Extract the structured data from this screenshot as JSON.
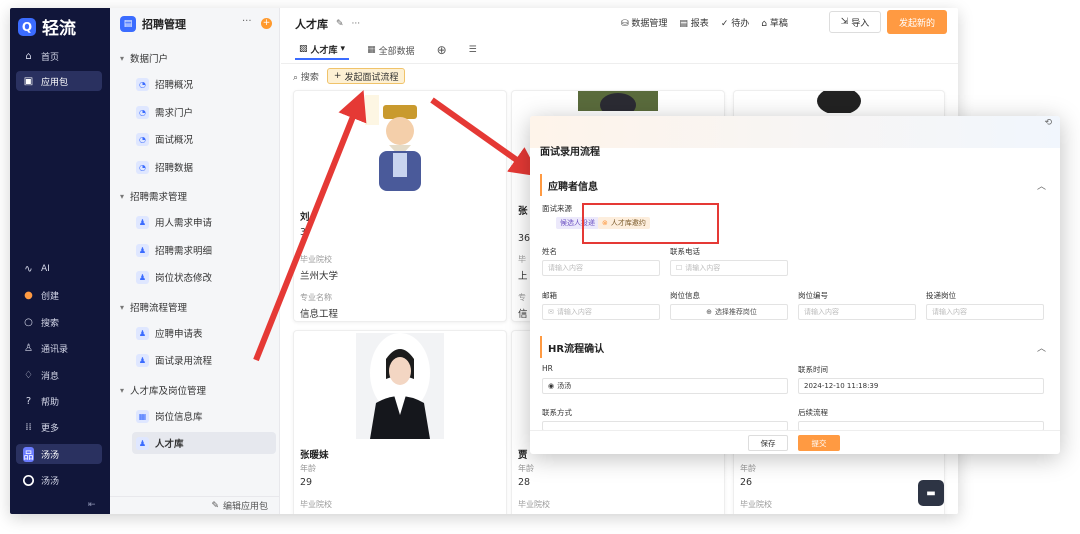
{
  "nav": {
    "brand": "轻流",
    "items": [
      {
        "label": "首页",
        "icon": "home-icon"
      },
      {
        "label": "应用包",
        "icon": "apps-icon"
      }
    ],
    "bottom_items": [
      {
        "label": "AI",
        "icon": "ai-icon"
      },
      {
        "label": "创建",
        "icon": "create-icon"
      },
      {
        "label": "搜索",
        "icon": "search-icon"
      },
      {
        "label": "通讯录",
        "icon": "contacts-icon"
      },
      {
        "label": "消息",
        "icon": "bell-icon"
      },
      {
        "label": "帮助",
        "icon": "help-icon"
      },
      {
        "label": "更多",
        "icon": "grid-icon"
      },
      {
        "label": "汤汤",
        "icon": "workspace-icon"
      },
      {
        "label": "汤汤",
        "icon": "user-avatar-icon"
      }
    ]
  },
  "sidebar": {
    "app_name": "招聘管理",
    "groups": [
      {
        "label": "数据门户",
        "items": [
          "招聘概况",
          "需求门户",
          "面试概况",
          "招聘数据"
        ]
      },
      {
        "label": "招聘需求管理",
        "items": [
          "用人需求申请",
          "招聘需求明细",
          "岗位状态修改"
        ]
      },
      {
        "label": "招聘流程管理",
        "items": [
          "应聘申请表",
          "面试录用流程"
        ]
      },
      {
        "label": "人才库及岗位管理",
        "items": [
          "岗位信息库",
          "人才库"
        ]
      }
    ],
    "footer": "编辑应用包"
  },
  "main": {
    "title": "人才库",
    "toolbar": [
      "数据管理",
      "报表",
      "待办",
      "草稿"
    ],
    "import_label": "导入",
    "new_label": "发起新的",
    "tabs": [
      "人才库",
      "全部数据"
    ],
    "search_label": "搜索",
    "flow_button": "发起面试流程",
    "cards": [
      {
        "name": "刘",
        "age": "3",
        "school_label": "毕业院校",
        "school": "兰州大学",
        "major_label": "专业名称",
        "major": "信息工程"
      },
      {
        "name": "张",
        "age": "36",
        "school_label": "毕",
        "school": "上",
        "major_label": "专",
        "major": "信"
      },
      {
        "name": "张暖妹",
        "age_label": "年龄",
        "age": "29",
        "school_label": "毕业院校",
        "school": ""
      },
      {
        "name": "贾",
        "age_label": "年龄",
        "age": "28",
        "school_label": "毕业院校",
        "school": ""
      },
      {
        "name": "",
        "age_label": "年龄",
        "age": "26",
        "school_label": "毕业院校",
        "school": ""
      }
    ]
  },
  "modal": {
    "title": "面试录用流程",
    "section1": "应聘者信息",
    "source_label": "面试来源",
    "source_options": [
      "候选人投递",
      "人才库邀约"
    ],
    "fields_row1": [
      {
        "label": "姓名",
        "placeholder": "请输入内容"
      },
      {
        "label": "联系电话",
        "placeholder": "请输入内容"
      }
    ],
    "fields_row2": [
      {
        "label": "邮箱",
        "placeholder": "请输入内容"
      },
      {
        "label": "岗位信息",
        "placeholder": "选择推荐岗位"
      },
      {
        "label": "岗位编号",
        "placeholder": "请输入内容"
      },
      {
        "label": "投递岗位",
        "placeholder": "请输入内容"
      }
    ],
    "section2": "HR流程确认",
    "hr_label": "HR",
    "hr_value": "汤汤",
    "contact_time_label": "联系时间",
    "contact_time_value": "2024-12-10 11:18:39",
    "contact_method_label": "联系方式",
    "next_flow_label": "后续流程",
    "save": "保存",
    "submit": "提交"
  },
  "colors": {
    "accent": "#ff9a42",
    "nav_bg": "#11163a",
    "primary": "#3b6cff",
    "arrow": "#e53935"
  }
}
